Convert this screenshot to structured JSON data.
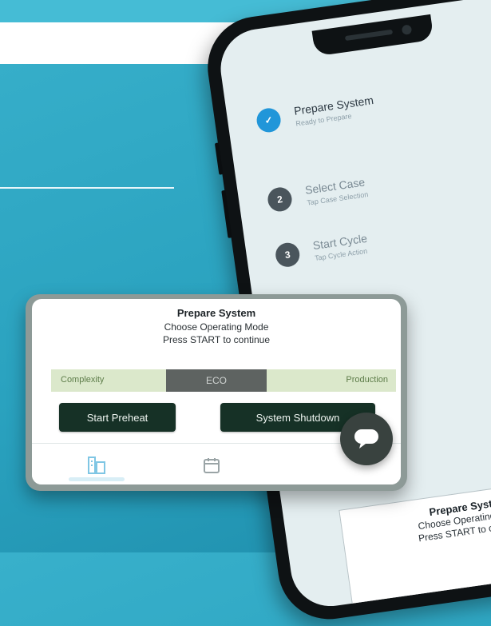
{
  "phone": {
    "steps": [
      {
        "number": "✓",
        "title": "Prepare System",
        "subtitle": "Ready to Prepare",
        "color": "#2196d9"
      },
      {
        "number": "2",
        "title": "Select Case",
        "subtitle": "Tap Case Selection",
        "color": "#4a555c"
      },
      {
        "number": "3",
        "title": "Start Cycle",
        "subtitle": "Tap Cycle Action",
        "color": "#4a555c"
      }
    ],
    "mini_panel": {
      "title": "Prepare System",
      "line1": "Choose Operating Mode",
      "line2": "Press START to continue"
    }
  },
  "card": {
    "title": "Prepare System",
    "line1": "Choose Operating Mode",
    "line2": "Press START to continue",
    "mode_row": {
      "left_label": "Complexity",
      "center_value": "ECO",
      "right_label": "Production"
    },
    "buttons": {
      "preheat": "Start Preheat",
      "shutdown": "System Shutdown"
    },
    "nav_icons": [
      "building-icon",
      "calendar-icon"
    ],
    "fab_icon": "chat-icon"
  },
  "colors": {
    "background": "#2aa2bf",
    "button": "#163126",
    "mode_bar": "#dbe8cb",
    "step_active": "#2196d9"
  }
}
